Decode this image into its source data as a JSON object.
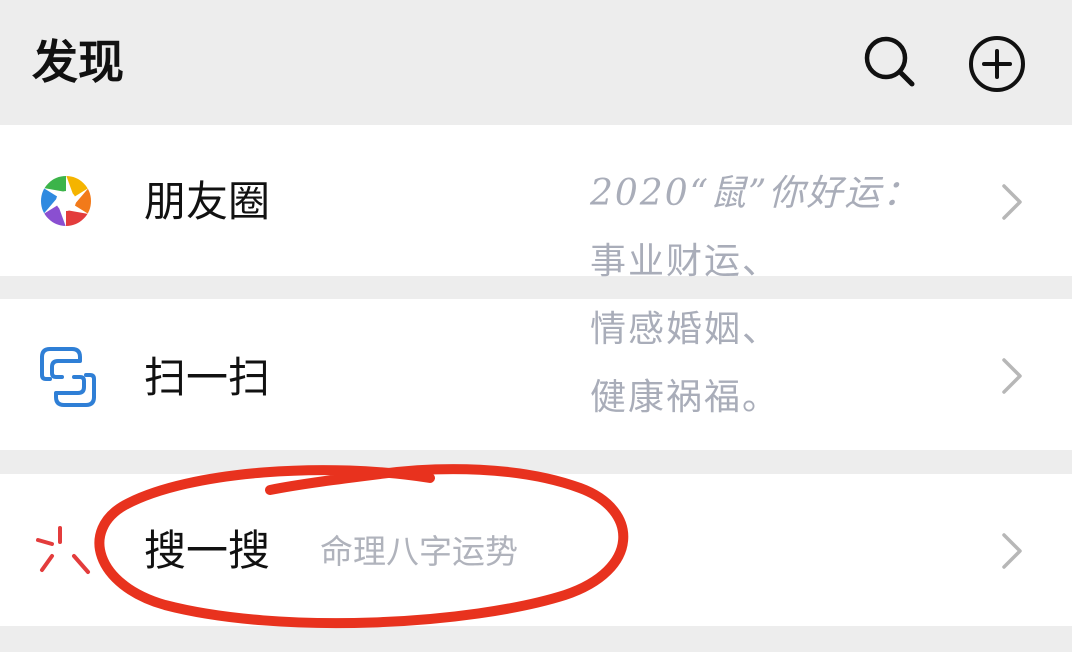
{
  "header": {
    "title": "发现",
    "search_icon": "search-icon",
    "add_icon": "plus-circle-icon"
  },
  "rows": {
    "moments": {
      "label": "朋友圈",
      "icon": "moments-aperture-icon"
    },
    "scan": {
      "label": "扫一扫",
      "icon": "scan-icon"
    },
    "search": {
      "label": "搜一搜",
      "hint": "命理八字运势",
      "icon": "search-sparkle-icon"
    }
  },
  "overlay": {
    "lines": [
      "2020“鼠”你好运：",
      "事业财运、",
      "情感婚姻、",
      "健康祸福。"
    ]
  },
  "colors": {
    "background": "#ededed",
    "row": "#ffffff",
    "annotation": "#e8321e",
    "scan_icon": "#2f7fd6"
  }
}
